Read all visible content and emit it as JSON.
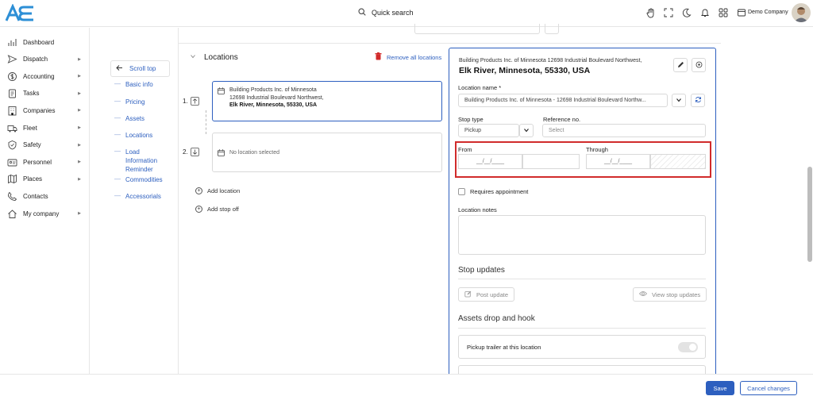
{
  "header": {
    "search_placeholder": "Quick search",
    "company_name": "Demo Company",
    "icons": [
      "hand-icon",
      "expand-icon",
      "moon-icon",
      "bell-icon",
      "grid-icon",
      "window-icon"
    ]
  },
  "sidebar": {
    "items": [
      {
        "label": "Dashboard",
        "icon": "chart-icon",
        "has_sub": false
      },
      {
        "label": "Dispatch",
        "icon": "send-icon",
        "has_sub": true
      },
      {
        "label": "Accounting",
        "icon": "dollar-icon",
        "has_sub": true
      },
      {
        "label": "Tasks",
        "icon": "clipboard-icon",
        "has_sub": true
      },
      {
        "label": "Companies",
        "icon": "building-icon",
        "has_sub": true
      },
      {
        "label": "Fleet",
        "icon": "truck-icon",
        "has_sub": true
      },
      {
        "label": "Safety",
        "icon": "shield-icon",
        "has_sub": true
      },
      {
        "label": "Personnel",
        "icon": "id-card-icon",
        "has_sub": true
      },
      {
        "label": "Places",
        "icon": "map-icon",
        "has_sub": true
      },
      {
        "label": "Contacts",
        "icon": "phone-icon",
        "has_sub": false
      },
      {
        "label": "My company",
        "icon": "home-icon",
        "has_sub": true
      }
    ]
  },
  "anchors": {
    "scroll_top": "Scroll top",
    "items": [
      "Basic info",
      "Pricing",
      "Assets",
      "Locations",
      "Load Information Reminder",
      "Commodities",
      "Accessorials"
    ]
  },
  "locations": {
    "title": "Locations",
    "remove_all": "Remove all locations",
    "stops": [
      {
        "number": "1.",
        "line1": "Building Products Inc. of Minnesota",
        "line2": "12698 Industrial Boulevard Northwest,",
        "line3": "Elk River, Minnesota, 55330, USA"
      },
      {
        "number": "2.",
        "line1": "No location selected",
        "line2": "",
        "line3": ""
      }
    ],
    "add_location": "Add location",
    "add_stop_off": "Add stop off"
  },
  "details": {
    "address_line1": "Building Products Inc. of Minnesota 12698 Industrial Boulevard Northwest,",
    "address_line2": "Elk River, Minnesota, 55330, USA",
    "location_name_label": "Location name *",
    "location_name_value": "Building Products Inc. of Minnesota - 12698 Industrial Boulevard Northw...",
    "stop_type_label": "Stop type",
    "stop_type_value": "Pickup",
    "reference_label": "Reference no.",
    "reference_placeholder": "Select",
    "from_label": "From",
    "through_label": "Through",
    "date_placeholder": "__/__/____",
    "requires_appointment": "Requires appointment",
    "notes_label": "Location notes",
    "stop_updates_title": "Stop updates",
    "post_update": "Post update",
    "view_stop_updates": "View stop updates",
    "assets_title": "Assets drop and hook",
    "pickup_trailer": "Pickup trailer at this location"
  },
  "footer": {
    "save": "Save",
    "cancel": "Cancel changes"
  }
}
